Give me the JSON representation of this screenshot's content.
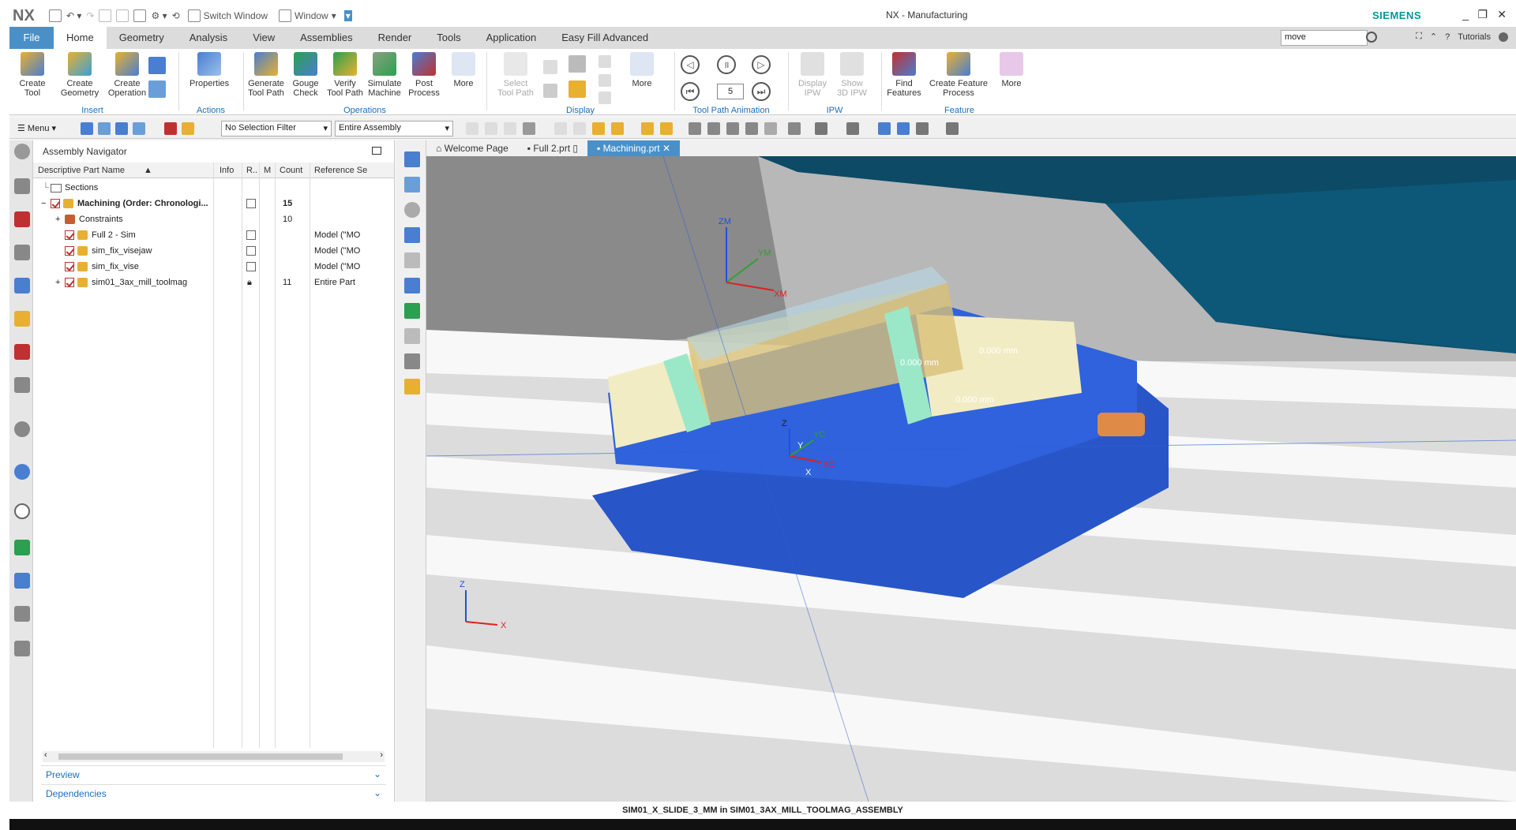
{
  "titlebar": {
    "logo": "NX",
    "switch_window": "Switch Window",
    "window": "Window",
    "title": "NX - Manufacturing",
    "brand": "SIEMENS"
  },
  "menu_tabs": [
    "File",
    "Home",
    "Geometry",
    "Analysis",
    "View",
    "Assemblies",
    "Render",
    "Tools",
    "Application",
    "Easy Fill Advanced"
  ],
  "command_finder": {
    "value": "move"
  },
  "tutorials": "Tutorials",
  "ribbon": {
    "insert": {
      "label": "Insert",
      "buttons": [
        "Create\nTool",
        "Create\nGeometry",
        "Create\nOperation"
      ]
    },
    "actions": {
      "label": "Actions",
      "buttons": [
        "Properties"
      ]
    },
    "operations": {
      "label": "Operations",
      "buttons": [
        "Generate\nTool Path",
        "Gouge\nCheck",
        "Verify\nTool Path",
        "Simulate\nMachine",
        "Post\nProcess",
        "More"
      ]
    },
    "display": {
      "label": "Display",
      "buttons": [
        "Select\nTool Path",
        "More"
      ]
    },
    "animation": {
      "label": "Tool Path Animation",
      "speed": "5"
    },
    "ipw": {
      "label": "IPW",
      "buttons": [
        "Display\nIPW",
        "Show\n3D IPW"
      ]
    },
    "feature": {
      "label": "Feature",
      "buttons": [
        "Find\nFeatures",
        "Create Feature\nProcess",
        "More"
      ]
    }
  },
  "selection_bar": {
    "menu": "Menu",
    "filter": "No Selection Filter",
    "scope": "Entire Assembly"
  },
  "navigator": {
    "title": "Assembly Navigator",
    "columns": [
      "Descriptive Part Name",
      "Info",
      "R..",
      "M",
      "Count",
      "Reference Se"
    ],
    "rows": [
      {
        "name": "Sections",
        "count": "",
        "ref": ""
      },
      {
        "name": "Machining (Order: Chronologi...",
        "count": "15",
        "ref": ""
      },
      {
        "name": "Constraints",
        "count": "10",
        "ref": ""
      },
      {
        "name": "Full 2 - Sim",
        "count": "",
        "ref": "Model (\"MO"
      },
      {
        "name": "sim_fix_visejaw",
        "count": "",
        "ref": "Model (\"MO"
      },
      {
        "name": "sim_fix_vise",
        "count": "",
        "ref": "Model (\"MO"
      },
      {
        "name": "sim01_3ax_mill_toolmag",
        "count": "11",
        "ref": "Entire Part"
      }
    ],
    "panels": [
      "Preview",
      "Dependencies"
    ]
  },
  "doc_tabs": [
    "Welcome Page",
    "Full 2.prt",
    "Machining.prt"
  ],
  "viewport_labels": {
    "zm": "ZM",
    "ym": "YM",
    "xm": "XM",
    "zc": "Z",
    "yc": "YC",
    "xc": "XC",
    "y": "Y",
    "x": "X",
    "dim1": "0.000 mm",
    "dim2": "0.000 mm",
    "dim3": "0.000 mm",
    "triad_z": "Z",
    "triad_x": "X"
  },
  "status": "SIM01_X_SLIDE_3_MM in SIM01_3AX_MILL_TOOLMAG_ASSEMBLY",
  "colors": {
    "accent": "#4a90c8",
    "brand": "#009999",
    "vise": "#2856c8",
    "stock": "#f2ecc4"
  }
}
